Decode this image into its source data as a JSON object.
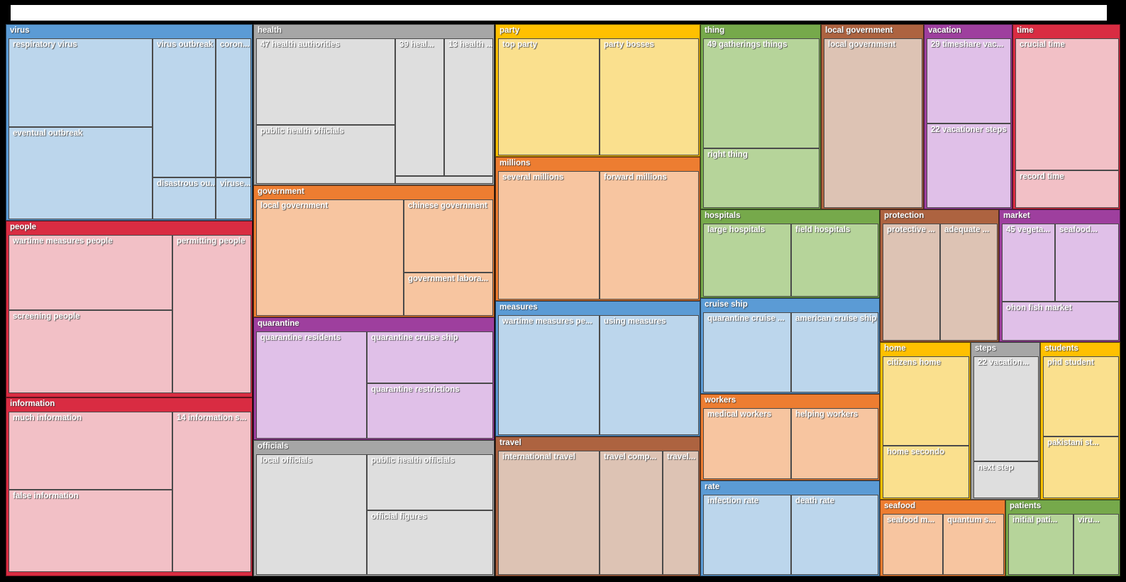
{
  "window": {
    "titlebar_text": ""
  },
  "chart_data": {
    "type": "treemap",
    "title": "",
    "note": "Hierarchical treemap of noun-phrase clusters; group header bar is the saturated color, leaf tiles the pale tint of the same hue.",
    "palette": {
      "blue_header": "#5b9bd5",
      "blue_leaf": "#bcd6ec",
      "gray_header": "#a6a6a6",
      "gray_leaf": "#dedede",
      "red_header": "#d92c42",
      "red_leaf": "#f2c0c6",
      "orange_header": "#ed7d31",
      "orange_leaf": "#f7c5a0",
      "yellow_header": "#ffc000",
      "yellow_leaf": "#fae08e",
      "green_header": "#76a94b",
      "green_leaf": "#b6d49a",
      "purple_header": "#9e3f9e",
      "purple_leaf": "#e0c0e8",
      "brown_header": "#ad6340",
      "brown_leaf": "#ddc3b4"
    },
    "groups": [
      {
        "label": "virus",
        "color": "blue",
        "leaves": [
          "respiratory virus",
          "eventual outbreak",
          "virus outbreak",
          "coron...",
          "disastrous ou...",
          "viruse..."
        ]
      },
      {
        "label": "people",
        "color": "red",
        "leaves": [
          "wartime measures people",
          "screening people",
          "permitting people"
        ]
      },
      {
        "label": "information",
        "color": "red",
        "leaves": [
          "much information",
          "false information",
          "14 information s..."
        ]
      },
      {
        "label": "health",
        "color": "gray",
        "leaves": [
          "47 health authorities",
          "public health officials",
          "39 heal...",
          "13 health ...",
          ""
        ]
      },
      {
        "label": "government",
        "color": "orange",
        "leaves": [
          "local government",
          "chinese government",
          "government labora..."
        ]
      },
      {
        "label": "quarantine",
        "color": "purple",
        "leaves": [
          "quarantine residents",
          "quarantine cruise ship",
          "quarantine restrictions"
        ]
      },
      {
        "label": "officials",
        "color": "gray",
        "leaves": [
          "local officials",
          "public health officials",
          "official figures"
        ]
      },
      {
        "label": "party",
        "color": "yellow",
        "leaves": [
          "top party",
          "party bosses"
        ]
      },
      {
        "label": "millions",
        "color": "orange",
        "leaves": [
          "several millions",
          "forward millions"
        ]
      },
      {
        "label": "measures",
        "color": "blue",
        "leaves": [
          "wartime measures pe...",
          "using measures"
        ]
      },
      {
        "label": "travel",
        "color": "brown",
        "leaves": [
          "international travel",
          "travel comp...",
          "travel..."
        ]
      },
      {
        "label": "thing",
        "color": "green",
        "leaves": [
          "49 gatherings things",
          "right thing"
        ]
      },
      {
        "label": "hospitals",
        "color": "green",
        "leaves": [
          "large hospitals",
          "field hospitals"
        ]
      },
      {
        "label": "cruise ship",
        "color": "blue",
        "leaves": [
          "quarantine cruise ...",
          "american cruise ship"
        ]
      },
      {
        "label": "workers",
        "color": "orange",
        "leaves": [
          "medical workers",
          "helping workers"
        ]
      },
      {
        "label": "rate",
        "color": "blue",
        "leaves": [
          "infection rate",
          "death rate"
        ]
      },
      {
        "label": "local government",
        "color": "brown",
        "leaves": [
          "local government"
        ]
      },
      {
        "label": "vacation",
        "color": "purple",
        "leaves": [
          "29 timeshare vac...",
          "22 vacationer steps"
        ]
      },
      {
        "label": "time",
        "color": "red",
        "leaves": [
          "crucial time",
          "record time"
        ]
      },
      {
        "label": "protection",
        "color": "brown",
        "leaves": [
          "protective ...",
          "adequate ..."
        ]
      },
      {
        "label": "market",
        "color": "purple",
        "leaves": [
          "45 vegeta...",
          "seafood...",
          "ohon fish market"
        ]
      },
      {
        "label": "home",
        "color": "yellow",
        "leaves": [
          "citizens home",
          "home secondo"
        ]
      },
      {
        "label": "steps",
        "color": "gray",
        "leaves": [
          "22 vacation...",
          "next step"
        ]
      },
      {
        "label": "students",
        "color": "yellow",
        "leaves": [
          "phd student",
          "pakistani st..."
        ]
      },
      {
        "label": "seafood",
        "color": "orange",
        "leaves": [
          "seafood m...",
          "quantum s..."
        ]
      },
      {
        "label": "patients",
        "color": "green",
        "leaves": [
          "initial pati...",
          "viru..."
        ]
      }
    ]
  },
  "groups": {
    "virus": {
      "header": "virus",
      "l0": "respiratory virus",
      "l1": "eventual outbreak",
      "l2": "virus outbreak",
      "l3": "coron...",
      "l4": "disastrous ou...",
      "l5": "viruse..."
    },
    "people": {
      "header": "people",
      "l0": "wartime measures people",
      "l1": "screening people",
      "l2": "permitting people"
    },
    "information": {
      "header": "information",
      "l0": "much information",
      "l1": "false information",
      "l2": "14 information s..."
    },
    "health": {
      "header": "health",
      "l0": "47 health authorities",
      "l1": "public health officials",
      "l2": "39 heal...",
      "l3": "13 health ...",
      "l4": ""
    },
    "government": {
      "header": "government",
      "l0": "local government",
      "l1": "chinese government",
      "l2": "government labora..."
    },
    "quarantine": {
      "header": "quarantine",
      "l0": "quarantine residents",
      "l1": "quarantine cruise ship",
      "l2": "quarantine restrictions"
    },
    "officials": {
      "header": "officials",
      "l0": "local officials",
      "l1": "public health officials",
      "l2": "official figures"
    },
    "party": {
      "header": "party",
      "l0": "top party",
      "l1": "party bosses"
    },
    "millions": {
      "header": "millions",
      "l0": "several millions",
      "l1": "forward millions"
    },
    "measures": {
      "header": "measures",
      "l0": "wartime measures pe...",
      "l1": "using measures"
    },
    "travel": {
      "header": "travel",
      "l0": "international travel",
      "l1": "travel comp...",
      "l2": "travel..."
    },
    "thing": {
      "header": "thing",
      "l0": "49 gatherings things",
      "l1": "right thing"
    },
    "hospitals": {
      "header": "hospitals",
      "l0": "large hospitals",
      "l1": "field hospitals"
    },
    "cruise_ship": {
      "header": "cruise ship",
      "l0": "quarantine cruise ...",
      "l1": "american cruise ship"
    },
    "workers": {
      "header": "workers",
      "l0": "medical workers",
      "l1": "helping workers"
    },
    "rate": {
      "header": "rate",
      "l0": "infection rate",
      "l1": "death rate"
    },
    "local_government": {
      "header": "local government",
      "l0": "local government"
    },
    "vacation": {
      "header": "vacation",
      "l0": "29 timeshare vac...",
      "l1": "22 vacationer steps"
    },
    "time": {
      "header": "time",
      "l0": "crucial time",
      "l1": "record time"
    },
    "protection": {
      "header": "protection",
      "l0": "protective ...",
      "l1": "adequate ..."
    },
    "market": {
      "header": "market",
      "l0": "45 vegeta...",
      "l1": "seafood...",
      "l2": "ohon fish market"
    },
    "home": {
      "header": "home",
      "l0": "citizens home",
      "l1": "home secondo"
    },
    "steps": {
      "header": "steps",
      "l0": "22 vacation...",
      "l1": "next step"
    },
    "students": {
      "header": "students",
      "l0": "phd student",
      "l1": "pakistani st..."
    },
    "seafood": {
      "header": "seafood",
      "l0": "seafood m...",
      "l1": "quantum s..."
    },
    "patients": {
      "header": "patients",
      "l0": "initial pati...",
      "l1": "viru..."
    }
  }
}
